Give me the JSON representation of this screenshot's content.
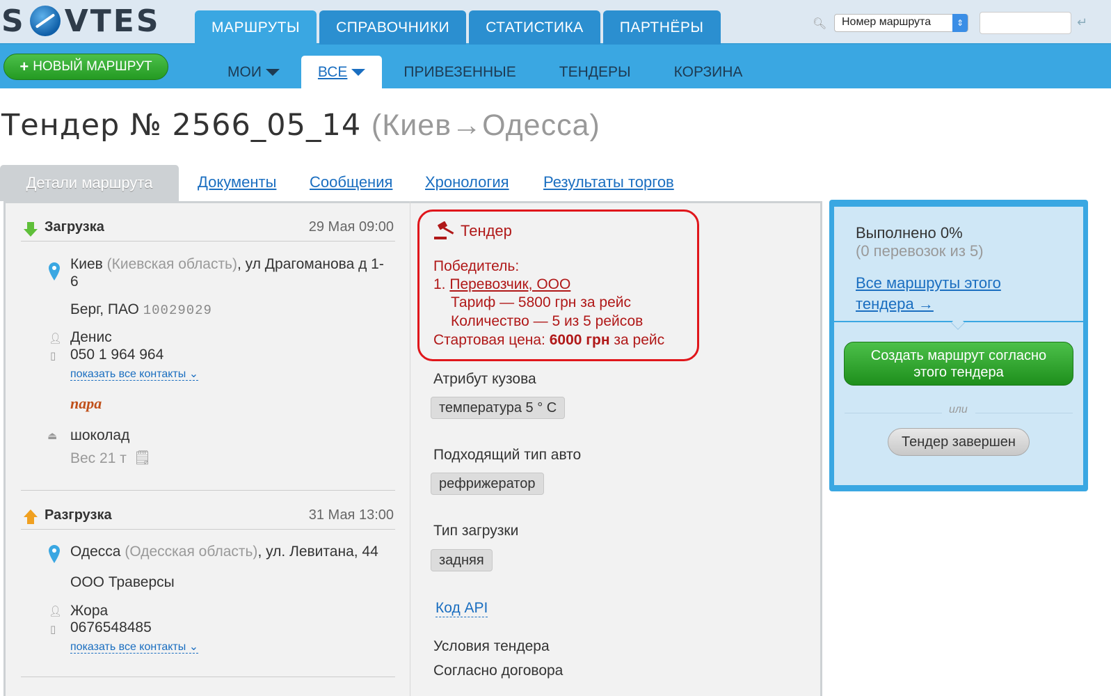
{
  "app": {
    "logo_text_left": "S",
    "logo_text_right": "VTES"
  },
  "main_tabs": [
    {
      "label": "МАРШРУТЫ"
    },
    {
      "label": "СПРАВОЧНИКИ"
    },
    {
      "label": "СТАТИСТИКА"
    },
    {
      "label": "ПАРТНЁРЫ"
    }
  ],
  "search": {
    "select_value": "Номер маршрута",
    "input_value": ""
  },
  "new_route_button": {
    "label": "НОВЫЙ МАРШРУТ"
  },
  "sub_nav": [
    {
      "label": "МОИ"
    },
    {
      "label": "ВСЕ"
    },
    {
      "label": "ПРИВЕЗЕННЫЕ"
    },
    {
      "label": "ТЕНДЕРЫ"
    },
    {
      "label": "КОРЗИНА"
    }
  ],
  "page": {
    "title": "Тендер № 2566_05_14",
    "route": "(Киев→Одесса)"
  },
  "detail_tabs": [
    {
      "label": "Детали маршрута"
    },
    {
      "label": "Документы"
    },
    {
      "label": "Сообщения"
    },
    {
      "label": "Хронология"
    },
    {
      "label": "Результаты торгов"
    }
  ],
  "loading": {
    "label": "Загрузка",
    "date": "29 Мая 09:00",
    "city": "Киев",
    "region": "(Киевская область)",
    "address_line1": ", ул Драгоманова д 1-",
    "address_line2": "6",
    "company": "Берг, ПАО",
    "company_code": "10029029",
    "contact_name": "Денис",
    "contact_phone": "050 1 964 964",
    "show_contacts": "показать все контакты",
    "note": "пара",
    "cargo": "шоколад",
    "weight": "Вес 21 т"
  },
  "unloading": {
    "label": "Разгрузка",
    "date": "31 Мая 13:00",
    "city": "Одесса",
    "region": "(Одесская область)",
    "address": ", ул. Левитана, 44",
    "company": "ООО Траверсы",
    "contact_name": "Жора",
    "contact_phone": "0676548485",
    "show_contacts": "показать все контакты"
  },
  "tender": {
    "heading": "Тендер",
    "winner_label": "Победитель:",
    "winner_index": "1.",
    "winner_name": "Перевозчик, ООО",
    "tariff": "Тариф — 5800 грн за рейс",
    "quantity": "Количество — 5 из 5 рейсов",
    "start_price_label": "Стартовая цена:",
    "start_price_value": "6000 грн",
    "start_price_suffix": "за рейс"
  },
  "attributes": {
    "body_label": "Атрибут кузова",
    "body_value": "температура 5 ° С",
    "vehicle_label": "Подходящий тип авто",
    "vehicle_value": "рефрижератор",
    "load_label": "Тип загрузки",
    "load_value": "задняя",
    "api_link": "Код API",
    "conditions_label": "Условия тендера",
    "conditions_value": "Согласно договора"
  },
  "side_panel": {
    "done": "Выполнено 0%",
    "done_detail": "(0 перевозок из 5)",
    "all_routes_link_1": "Все маршруты этого",
    "all_routes_link_2": "тендера →",
    "create_btn_1": "Создать маршрут согласно",
    "create_btn_2": "этого тендера",
    "or": "или",
    "finished_btn": "Тендер завершен"
  },
  "colors": {
    "accent": "#3aa7e2",
    "green": "#2aa628",
    "red": "#b01818",
    "link": "#1a6ec0"
  }
}
